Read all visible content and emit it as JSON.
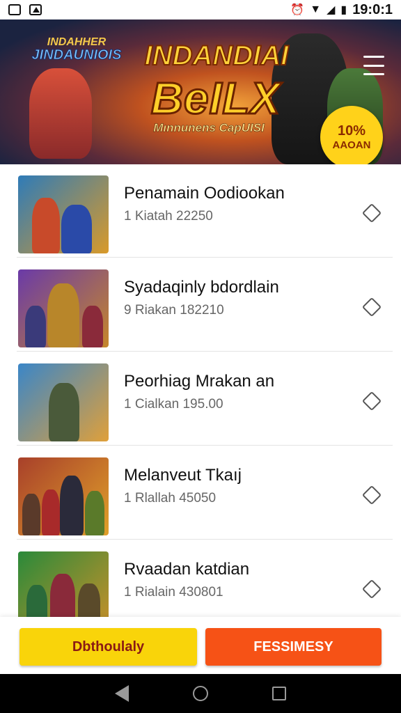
{
  "status_bar": {
    "time": "19:0:1",
    "icons": [
      "screenshot-icon",
      "notification-icon",
      "alarm-icon",
      "wifi-icon",
      "signal-icon",
      "battery-icon"
    ]
  },
  "hero": {
    "small_title_line1": "INDAHHER",
    "small_title_line2": "JINDAUNIOIS",
    "title_line1": "INDANDIAI",
    "title_line2": "BeILX",
    "subtitle": "Mınnunens CapUISI",
    "badge_percent": "10%",
    "badge_label": "AAOAN"
  },
  "list": {
    "items": [
      {
        "title": "Penamain Oodiookan",
        "subtitle": "1 Kiatah 22250",
        "thumb_colors": [
          "#2e7bb8",
          "#d99a2a"
        ]
      },
      {
        "title": "Syadaqinly bdordlain",
        "subtitle": "9 Riakan 182210",
        "thumb_colors": [
          "#6a3aa8",
          "#c6872a"
        ]
      },
      {
        "title": "Peorhiag Mrakan an",
        "subtitle": "1 Cialkan 195.00",
        "thumb_colors": [
          "#3a86c8",
          "#e0a03a"
        ]
      },
      {
        "title": "Melanveut Tkaıj",
        "subtitle": "1 Rlallah 45050",
        "thumb_colors": [
          "#a8402a",
          "#e0a02a"
        ]
      },
      {
        "title": "Rvaadan katdian",
        "subtitle": "1 Rialain 430801",
        "thumb_colors": [
          "#2a8a3a",
          "#c8902a"
        ]
      }
    ]
  },
  "bottom_bar": {
    "primary_label": "Dbthoulaly",
    "secondary_label": "FESSIMESY"
  },
  "colors": {
    "primary_button": "#f9d40a",
    "secondary_button": "#f65216"
  }
}
